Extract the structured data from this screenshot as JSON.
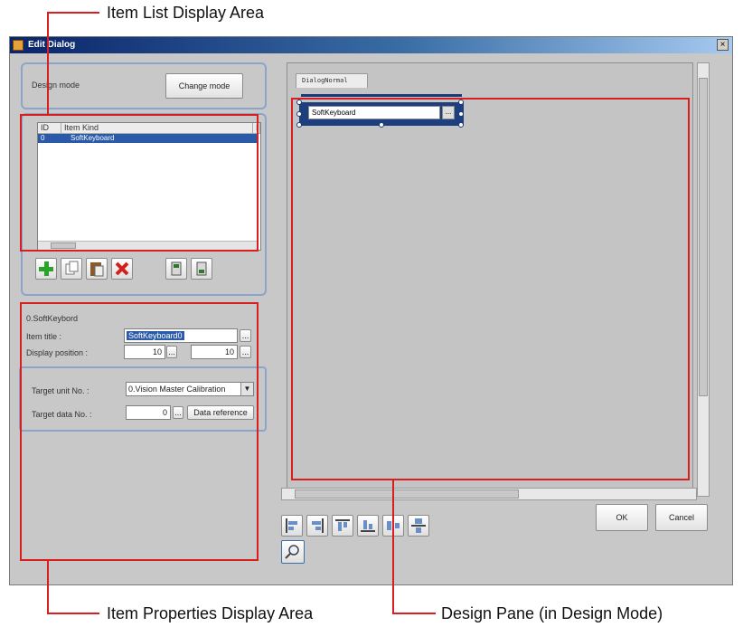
{
  "callouts": {
    "item_list": "Item List Display Area",
    "item_properties": "Item Properties Display Area",
    "design_pane": "Design Pane (in Design Mode)"
  },
  "window": {
    "title": "Edit Dialog",
    "close": "×"
  },
  "mode": {
    "label": "Design mode",
    "button": "Change mode"
  },
  "item_list": {
    "columns": [
      "ID",
      "Item Kind",
      "I"
    ],
    "rows": [
      {
        "id": "0",
        "kind": "SoftKeyboard"
      }
    ]
  },
  "list_tools": [
    "add-icon",
    "copy-icon",
    "paste-icon",
    "delete-icon",
    "move-up-icon",
    "move-down-icon"
  ],
  "properties": {
    "header": "0.SoftKeybord",
    "item_title_label": "Item title :",
    "item_title_value": "SoftKeyboard0",
    "display_position_label": "Display position :",
    "pos_x": "10",
    "pos_y": "10",
    "target_unit_label": "Target unit No. :",
    "target_unit_value": "0.Vision Master Calibration",
    "target_data_label": "Target data No. :",
    "target_data_value": "0",
    "data_reference_button": "Data reference",
    "ellipsis": "..."
  },
  "design": {
    "tab": "DialogNormal",
    "widget_label": "SoftKeyboard",
    "widget_button": "..."
  },
  "align_tools": [
    "align-left-icon",
    "align-right-icon",
    "align-top-icon",
    "align-bottom-icon",
    "center-horizontal-icon",
    "center-vertical-icon"
  ],
  "zoom_tool": "zoom-icon",
  "footer": {
    "ok": "OK",
    "cancel": "Cancel"
  },
  "colors": {
    "callout_red": "#d81e1e",
    "selection_blue": "#2b5ba8",
    "panel_border": "#8aa4cc"
  }
}
